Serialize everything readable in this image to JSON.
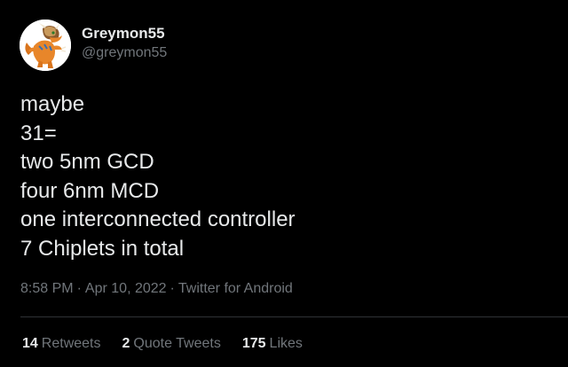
{
  "author": {
    "display_name": "Greymon55",
    "handle": "@greymon55",
    "avatar_icon": "orange-dinosaur-avatar"
  },
  "tweet": {
    "lines": [
      "maybe",
      "31=",
      "two 5nm GCD",
      "four 6nm MCD",
      "one interconnected controller",
      "7 Chiplets in total"
    ]
  },
  "meta": {
    "time": "8:58 PM",
    "separator": "·",
    "date": "Apr 10, 2022",
    "source": "Twitter for Android"
  },
  "stats": {
    "retweets_count": "14",
    "retweets_label": "Retweets",
    "quotes_count": "2",
    "quotes_label": "Quote Tweets",
    "likes_count": "175",
    "likes_label": "Likes"
  },
  "colors": {
    "background": "#000000",
    "primary_text": "#e7e9ea",
    "secondary_text": "#71767b",
    "divider": "#2f3336"
  }
}
